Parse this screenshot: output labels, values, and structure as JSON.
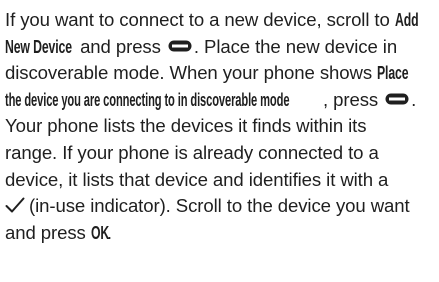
{
  "paragraph": {
    "l1_pre": "If you want to connect to a new device, scroll to ",
    "l1_ui": "Add",
    "l2_ui": "New Device",
    "l2_post": " and press ",
    "l2_end": ". Place the new device in",
    "l3": "discoverable mode. When your phone shows ",
    "l3_ui": "Place",
    "l4_ui": "the device you are connecting to in discoverable mode",
    "l4_post": ", press ",
    "l4_end": ".",
    "l5": "Your phone lists the devices it finds within its",
    "l6": "range. If your phone is already connected to a",
    "l7": "device, it lists that device and identifies it with a",
    "l8": "(in-use indicator). Scroll to the device you want",
    "l9_pre": "and press ",
    "l9_ui": "OK",
    "l9_end": "."
  },
  "icons": {
    "select_key": "center-select-key-icon",
    "in_use": "checkmark-icon"
  }
}
